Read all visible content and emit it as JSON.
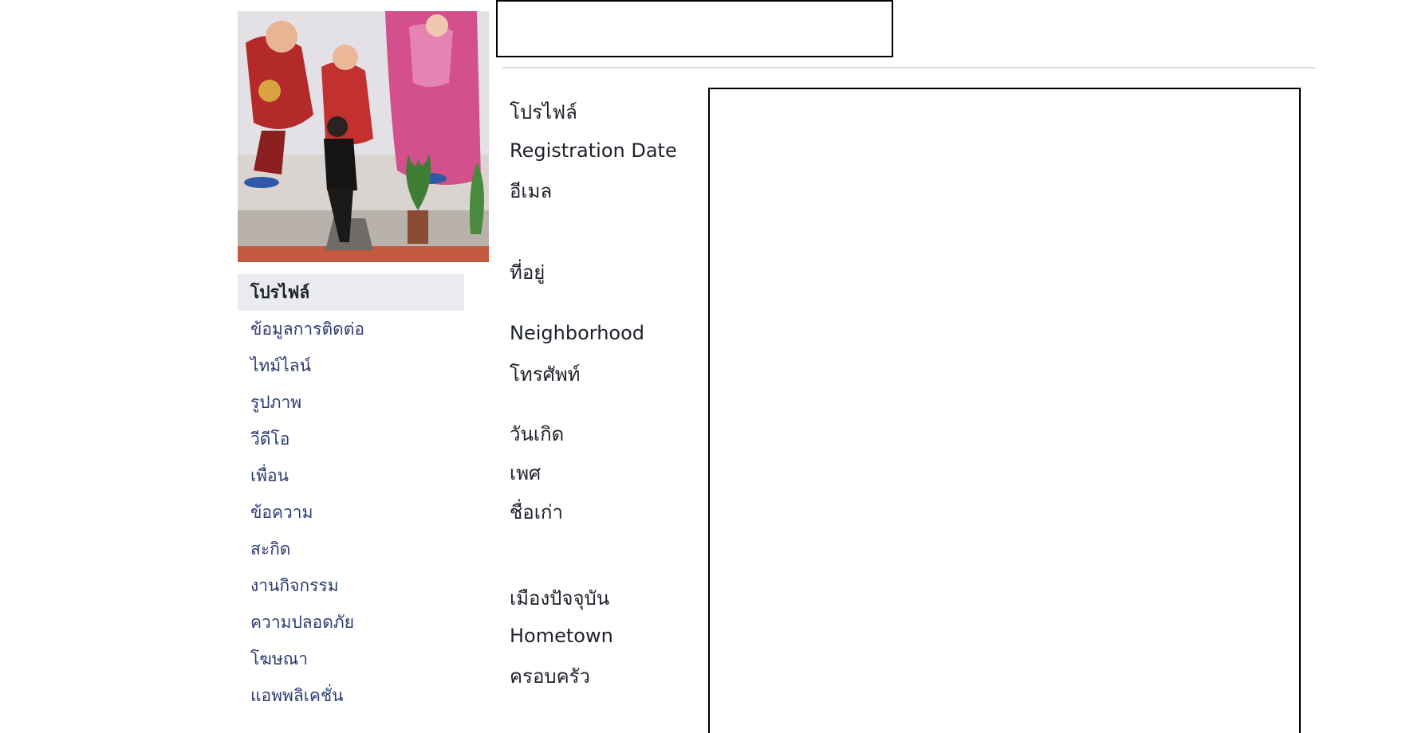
{
  "nav": {
    "items": [
      {
        "label": "โปรไฟล์"
      },
      {
        "label": "ข้อมูลการติดต่อ"
      },
      {
        "label": "ไทม์ไลน์"
      },
      {
        "label": "รูปภาพ"
      },
      {
        "label": "วีดีโอ"
      },
      {
        "label": "เพื่อน"
      },
      {
        "label": "ข้อความ"
      },
      {
        "label": "สะกิด"
      },
      {
        "label": "งานกิจกรรม"
      },
      {
        "label": "ความปลอดภัย"
      },
      {
        "label": "โฆษณา"
      },
      {
        "label": "แอพพลิเคชั่น"
      }
    ]
  },
  "fields": {
    "profile": "โปรไฟล์",
    "registration_date": "Registration Date",
    "email": "อีเมล",
    "address": "ที่อยู่",
    "neighborhood": "Neighborhood",
    "phone": "โทรศัพท์",
    "birthday": "วันเกิด",
    "gender": "เพศ",
    "former_name": "ชื่อเก่า",
    "current_city": "เมืองปัจจุบัน",
    "hometown": "Hometown",
    "family": "ครอบครัว"
  },
  "colors": {
    "nav_link": "#2c3b73",
    "active_bg": "#e9ebee",
    "divider": "#dddfe2"
  }
}
